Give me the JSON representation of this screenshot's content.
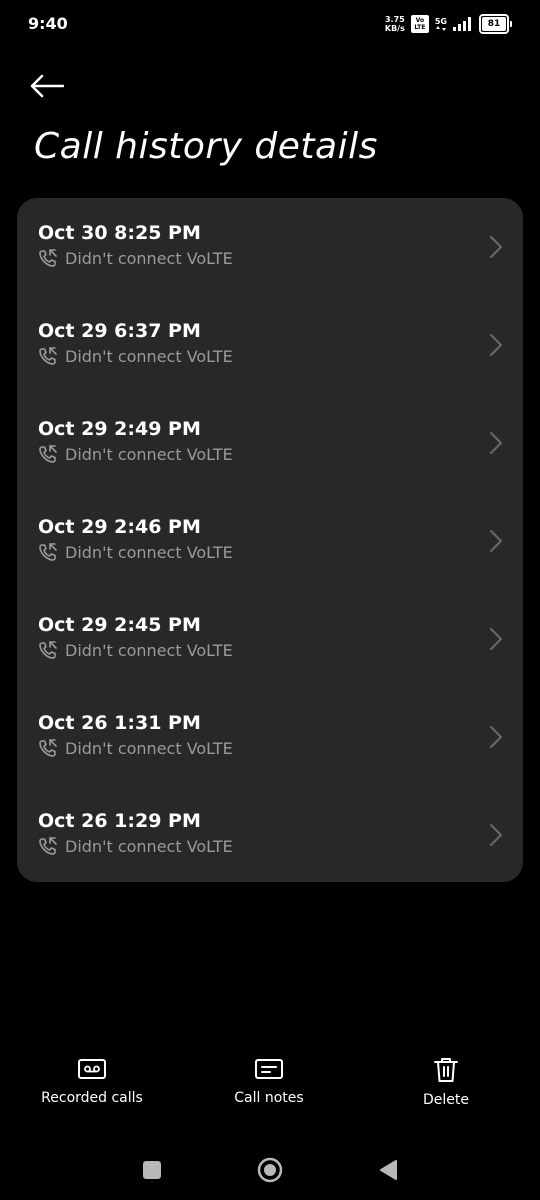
{
  "status_bar": {
    "time": "9:40",
    "net_speed_value": "3.75",
    "net_speed_unit": "KB/s",
    "volte_top": "Vo",
    "volte_bottom": "LTE",
    "network_type": "5G",
    "battery_level": "81"
  },
  "header": {
    "back_icon": "arrow-left-icon",
    "title": "Call history details"
  },
  "history": {
    "items": [
      {
        "datetime": "Oct 30 8:25 PM",
        "status": "Didn't connect VoLTE",
        "icon": "call-missed-icon"
      },
      {
        "datetime": "Oct 29 6:37 PM",
        "status": "Didn't connect VoLTE",
        "icon": "call-missed-icon"
      },
      {
        "datetime": "Oct 29 2:49 PM",
        "status": "Didn't connect VoLTE",
        "icon": "call-missed-icon"
      },
      {
        "datetime": "Oct 29 2:46 PM",
        "status": "Didn't connect VoLTE",
        "icon": "call-missed-icon"
      },
      {
        "datetime": "Oct 29 2:45 PM",
        "status": "Didn't connect VoLTE",
        "icon": "call-missed-icon"
      },
      {
        "datetime": "Oct 26 1:31 PM",
        "status": "Didn't connect VoLTE",
        "icon": "call-missed-icon"
      },
      {
        "datetime": "Oct 26 1:29 PM",
        "status": "Didn't connect VoLTE",
        "icon": "call-missed-icon"
      }
    ]
  },
  "actions": {
    "recorded_calls": {
      "label": "Recorded calls",
      "icon": "cassette-icon"
    },
    "call_notes": {
      "label": "Call notes",
      "icon": "note-icon"
    },
    "delete": {
      "label": "Delete",
      "icon": "trash-icon"
    }
  },
  "nav_bar": {
    "recents_icon": "square-icon",
    "home_icon": "circle-icon",
    "back_icon": "triangle-back-icon"
  },
  "colors": {
    "background": "#000000",
    "card": "#282828",
    "secondary_text": "#9a9a9a"
  }
}
